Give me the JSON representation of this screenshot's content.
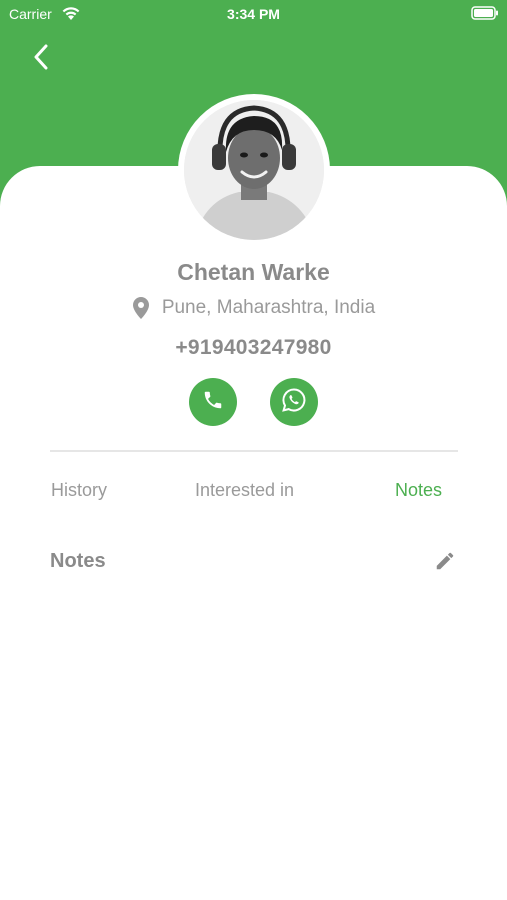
{
  "status_bar": {
    "carrier": "Carrier",
    "time": "3:34 PM",
    "wifi_icon": "wifi-icon",
    "battery_icon": "battery-icon"
  },
  "header": {
    "back_icon": "chevron-left-icon",
    "background_color": "#4CAF50"
  },
  "profile": {
    "name": "Chetan Warke",
    "location_icon": "location-pin-icon",
    "location": "Pune, Maharashtra, India",
    "phone": "+919403247980",
    "actions": [
      {
        "icon": "phone-icon"
      },
      {
        "icon": "whatsapp-icon"
      }
    ]
  },
  "tabs": [
    {
      "label": "History",
      "active": false
    },
    {
      "label": "Interested in",
      "active": false
    },
    {
      "label": "Notes",
      "active": true
    }
  ],
  "notes_section": {
    "title": "Notes",
    "edit_icon": "pencil-icon"
  },
  "colors": {
    "accent": "#4CAF50",
    "text_muted": "#8a8a8a"
  }
}
